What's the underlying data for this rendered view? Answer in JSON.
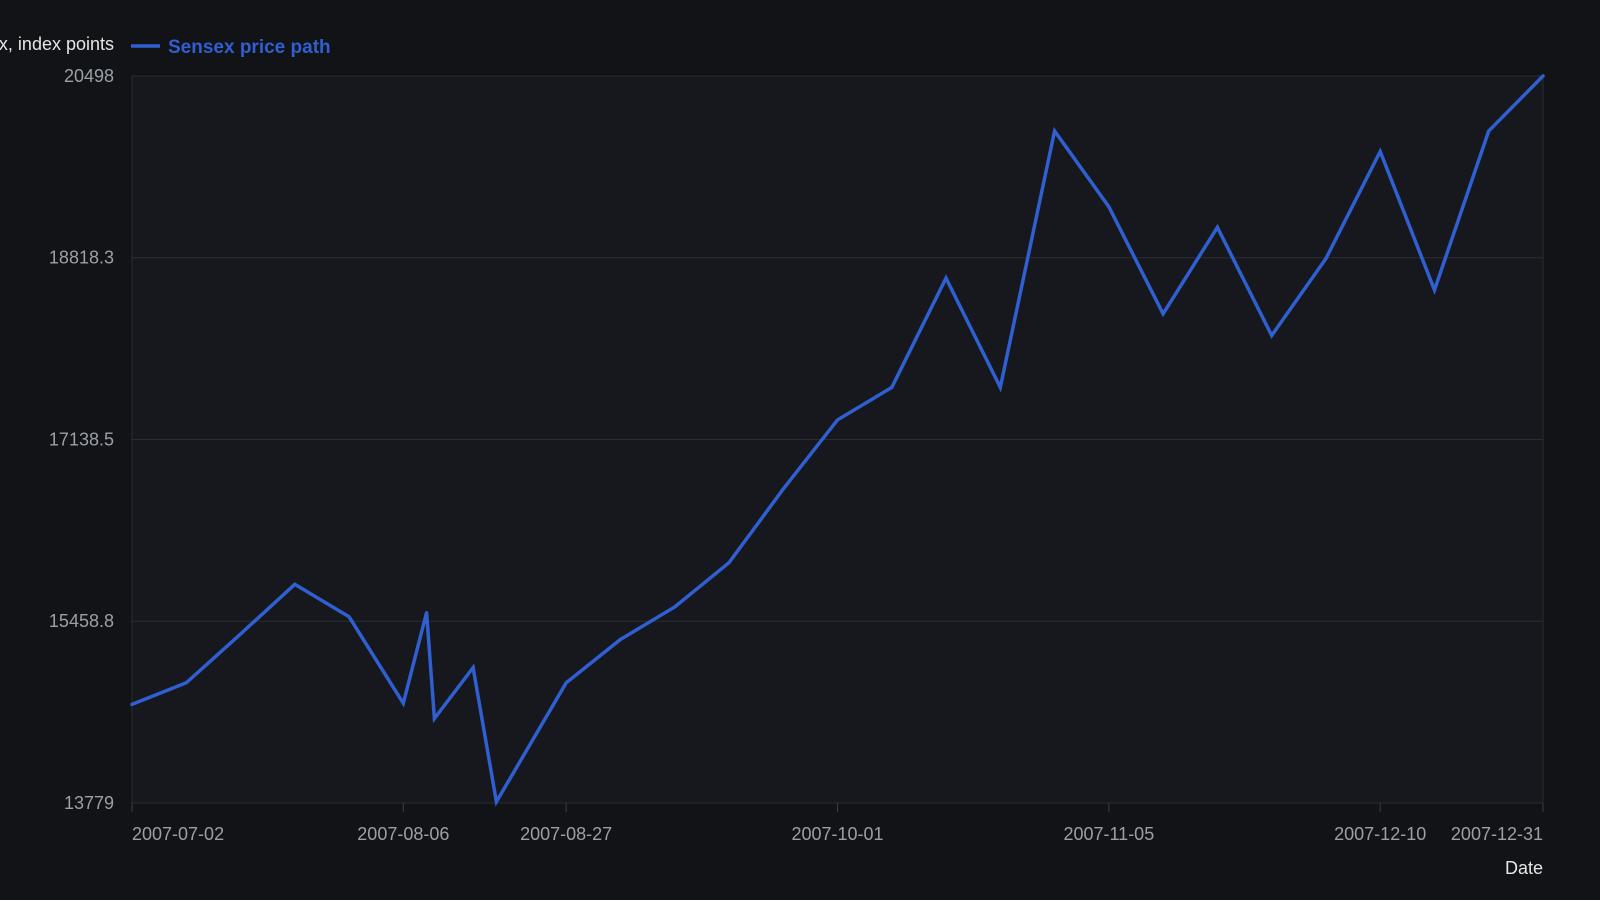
{
  "chart_data": {
    "type": "line",
    "ylabel": "Sensex, index points",
    "xlabel": "Date",
    "legend": "top-left",
    "grid": true,
    "ylim": [
      13779,
      20498
    ],
    "xlim": [
      "2007-07-02",
      "2007-12-31"
    ],
    "y_ticks": [
      "13779",
      "15458.8",
      "17138.5",
      "18818.3",
      "20498"
    ],
    "x_ticks": [
      "2007-07-02",
      "2007-08-06",
      "2007-08-27",
      "2007-10-01",
      "2007-11-05",
      "2007-12-10",
      "2007-12-31"
    ],
    "series": [
      {
        "name": "Sensex price path",
        "color": "#2f5fd0",
        "x": [
          "2007-07-02",
          "2007-07-09",
          "2007-07-16",
          "2007-07-23",
          "2007-07-30",
          "2007-08-06",
          "2007-08-09",
          "2007-08-10",
          "2007-08-15",
          "2007-08-18",
          "2007-08-27",
          "2007-09-03",
          "2007-09-10",
          "2007-09-17",
          "2007-09-24",
          "2007-10-01",
          "2007-10-08",
          "2007-10-15",
          "2007-10-22",
          "2007-10-29",
          "2007-11-05",
          "2007-11-12",
          "2007-11-19",
          "2007-11-26",
          "2007-12-03",
          "2007-12-10",
          "2007-12-17",
          "2007-12-24",
          "2007-12-31"
        ],
        "values": [
          14690,
          14890,
          15340,
          15800,
          15500,
          14700,
          15540,
          14560,
          15030,
          13790,
          14890,
          15290,
          15590,
          16000,
          16680,
          17320,
          17620,
          18630,
          17620,
          19990,
          19290,
          18300,
          19100,
          18100,
          18810,
          19800,
          18520,
          19990,
          20498
        ]
      }
    ]
  }
}
